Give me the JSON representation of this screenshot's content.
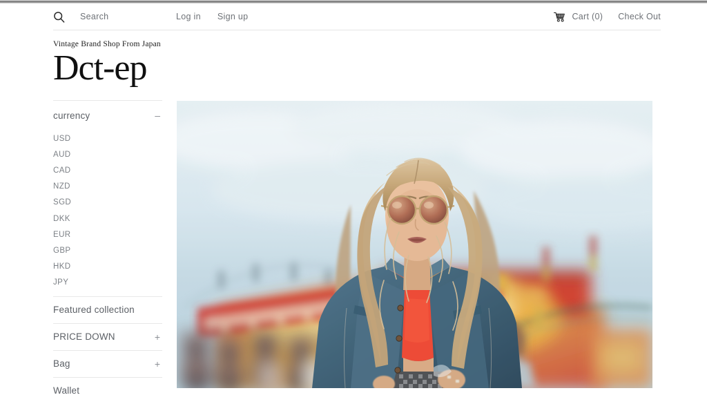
{
  "utility": {
    "search": {
      "icon": "search-icon",
      "label": "Search"
    },
    "login": "Log in",
    "signup": "Sign up",
    "cart": {
      "icon": "cart-icon",
      "label": "Cart (0)"
    },
    "checkout": "Check Out"
  },
  "brand": {
    "tagline": "Vintage Brand Shop From Japan",
    "title": "Dct-ep"
  },
  "sidebar": {
    "currency": {
      "title": "currency",
      "toggle": "–",
      "options": [
        "USD",
        "AUD",
        "CAD",
        "NZD",
        "SGD",
        "DKK",
        "EUR",
        "GBP",
        "HKD",
        "JPY"
      ]
    },
    "links": [
      {
        "label": "Featured collection",
        "toggle": ""
      },
      {
        "label": "PRICE DOWN",
        "toggle": "+"
      },
      {
        "label": "Bag",
        "toggle": "+"
      },
      {
        "label": "Wallet",
        "toggle": ""
      }
    ]
  },
  "hero": {
    "alt": "Blonde woman in denim jacket and red top wearing round sunglasses at a blurred funfair",
    "colors": {
      "sky": "#dce8ee",
      "sky_deep": "#bcd3dd",
      "stall_red": "#d8412e",
      "stall_gold": "#e7a53a",
      "denim": "#3f6177",
      "denim_dark": "#2c4a5d",
      "top_red": "#f2412b",
      "hair": "#c9a173",
      "skin": "#e4b894"
    }
  }
}
